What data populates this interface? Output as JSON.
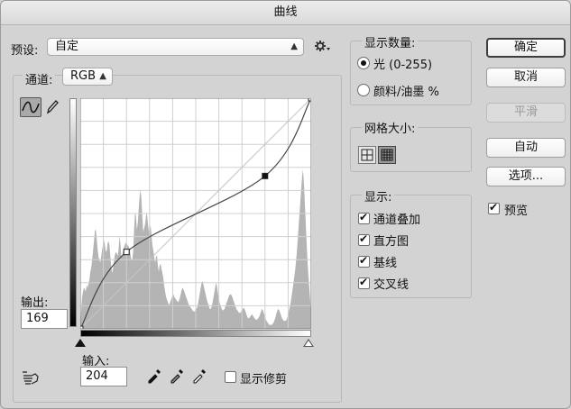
{
  "window": {
    "title": "曲线"
  },
  "preset": {
    "label": "预设:",
    "value": "自定"
  },
  "channel": {
    "label": "通道:",
    "value": "RGB"
  },
  "output": {
    "label": "输出:",
    "value": "169"
  },
  "input": {
    "label": "输入:",
    "value": "204"
  },
  "show_clipping": {
    "label": "显示修剪",
    "checked": false
  },
  "show_amount": {
    "title": "显示数量:",
    "options": [
      {
        "label": "光 (0-255)",
        "selected": true
      },
      {
        "label": "颜料/油墨 %",
        "selected": false
      }
    ]
  },
  "grid_size": {
    "title": "网格大小:",
    "options": [
      "simple-grid-icon",
      "detailed-grid-icon"
    ],
    "selected": "detailed-grid-icon"
  },
  "show": {
    "title": "显示:",
    "items": [
      {
        "label": "通道叠加",
        "checked": true
      },
      {
        "label": "直方图",
        "checked": true
      },
      {
        "label": "基线",
        "checked": true
      },
      {
        "label": "交叉线",
        "checked": true
      }
    ]
  },
  "buttons": {
    "ok": "确定",
    "cancel": "取消",
    "smooth": "平滑",
    "auto": "自动",
    "options": "选项..."
  },
  "preview": {
    "label": "预览",
    "checked": true
  },
  "curve": {
    "control_points": [
      [
        0,
        0
      ],
      [
        51,
        85
      ],
      [
        204,
        169
      ],
      [
        255,
        255
      ]
    ]
  },
  "histogram": [
    0,
    28,
    48,
    56,
    62,
    60,
    56,
    66,
    62,
    68,
    74,
    86,
    92,
    104,
    118,
    132,
    148,
    150,
    136,
    120,
    108,
    104,
    100,
    110,
    120,
    128,
    134,
    126,
    116,
    118,
    130,
    132,
    126,
    108,
    92,
    84,
    92,
    104,
    112,
    116,
    114,
    110,
    120,
    140,
    128,
    108,
    112,
    118,
    124,
    128,
    130,
    128,
    126,
    124,
    120,
    112,
    104,
    104,
    118,
    150,
    176,
    170,
    150,
    160,
    180,
    200,
    210,
    196,
    168,
    146,
    152,
    158,
    170,
    176,
    160,
    148,
    150,
    156,
    142,
    126,
    118,
    108,
    100,
    108,
    112,
    96,
    86,
    96,
    98,
    90,
    84,
    76,
    64,
    56,
    48,
    44,
    40,
    36,
    38,
    42,
    46,
    50,
    52,
    48,
    46,
    44,
    42,
    40,
    42,
    46,
    52,
    58,
    62,
    60,
    56,
    52,
    48,
    44,
    40,
    36,
    34,
    32,
    30,
    28,
    26,
    26,
    28,
    30,
    32,
    38,
    46,
    54,
    62,
    70,
    72,
    66,
    60,
    54,
    48,
    42,
    38,
    34,
    30,
    30,
    34,
    40,
    48,
    56,
    64,
    70,
    62,
    52,
    44,
    38,
    34,
    30,
    28,
    28,
    30,
    34,
    38,
    42,
    46,
    50,
    52,
    52,
    50,
    46,
    42,
    38,
    34,
    30,
    28,
    26,
    24,
    24,
    26,
    28,
    30,
    32,
    30,
    26,
    22,
    18,
    16,
    16,
    18,
    20,
    22,
    20,
    18,
    16,
    14,
    14,
    14,
    16,
    18,
    22,
    26,
    30,
    28,
    24,
    20,
    16,
    12,
    10,
    8,
    6,
    6,
    6,
    6,
    8,
    10,
    14,
    18,
    24,
    28,
    30,
    28,
    24,
    20,
    16,
    14,
    12,
    12,
    12,
    14,
    18,
    24,
    30,
    36,
    44,
    54,
    64,
    74,
    84,
    96,
    112,
    130,
    150,
    170,
    190,
    210,
    230,
    240,
    220,
    190,
    160,
    130,
    100,
    80,
    60,
    40,
    20
  ]
}
